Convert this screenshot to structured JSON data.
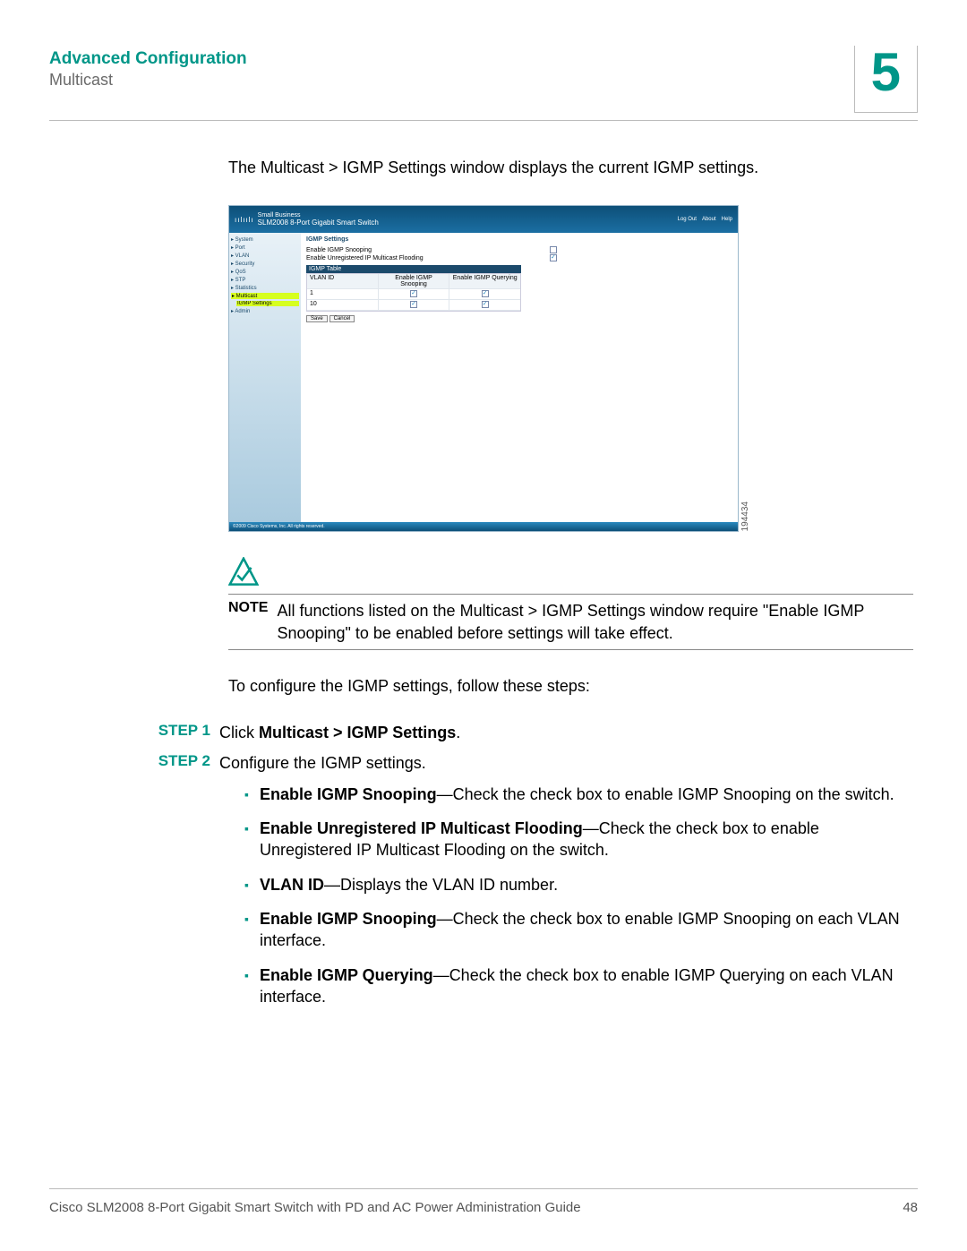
{
  "header": {
    "section": "Advanced Configuration",
    "subsection": "Multicast",
    "chapter": "5"
  },
  "intro": "The Multicast > IGMP Settings window displays the current IGMP settings.",
  "screenshot": {
    "brand_small": "Small Business",
    "brand_cisco": "cisco",
    "product": "SLM2008 8-Port Gigabit Smart Switch",
    "top_links": [
      "Log Out",
      "About",
      "Help"
    ],
    "nav": [
      "▸ System",
      "▸ Port",
      "▸ VLAN",
      "▸ Security",
      "▸ QoS",
      "▸ STP",
      "▸ Statistics",
      "▸ Multicast",
      "IGMP Settings",
      "▸ Admin"
    ],
    "nav_highlight_index": 8,
    "panel_title": "IGMP Settings",
    "option1": "Enable IGMP Snooping",
    "option1_checked": false,
    "option2": "Enable Unregistered IP Multicast Flooding",
    "option2_checked": true,
    "table_title": "IGMP Table",
    "columns": [
      "VLAN ID",
      "Enable IGMP Snooping",
      "Enable IGMP Querying"
    ],
    "rows": [
      {
        "vlan": "1",
        "snoop": true,
        "query": true
      },
      {
        "vlan": "10",
        "snoop": true,
        "query": true
      }
    ],
    "buttons": [
      "Save",
      "Cancel"
    ],
    "footer": "©2009 Cisco Systems, Inc. All rights reserved.",
    "figure_id": "194434"
  },
  "note": {
    "label": "NOTE",
    "text": "All functions listed on the Multicast > IGMP Settings window require \"Enable IGMP Snooping\" to be enabled before settings will take effect."
  },
  "prestep": "To configure the IGMP settings, follow these steps:",
  "steps": [
    {
      "label": "STEP 1",
      "text_prefix": "Click ",
      "text_bold": "Multicast > IGMP Settings",
      "text_suffix": "."
    },
    {
      "label": "STEP 2",
      "text_prefix": "Configure the IGMP settings.",
      "text_bold": "",
      "text_suffix": ""
    }
  ],
  "bullets": [
    {
      "bold": "Enable IGMP Snooping",
      "rest": "—Check the check box to enable IGMP Snooping on the switch."
    },
    {
      "bold": "Enable Unregistered IP Multicast Flooding",
      "rest": "—Check the check box to enable Unregistered IP Multicast Flooding on the switch."
    },
    {
      "bold": "VLAN ID",
      "rest": "—Displays the VLAN ID number."
    },
    {
      "bold": "Enable IGMP Snooping",
      "rest": "—Check the check box to enable IGMP Snooping on each VLAN interface."
    },
    {
      "bold": "Enable IGMP Querying",
      "rest": "—Check the check box to enable IGMP Querying on each VLAN interface."
    }
  ],
  "footer": {
    "left": "Cisco SLM2008 8-Port Gigabit Smart Switch with PD and AC Power Administration Guide",
    "right": "48"
  }
}
